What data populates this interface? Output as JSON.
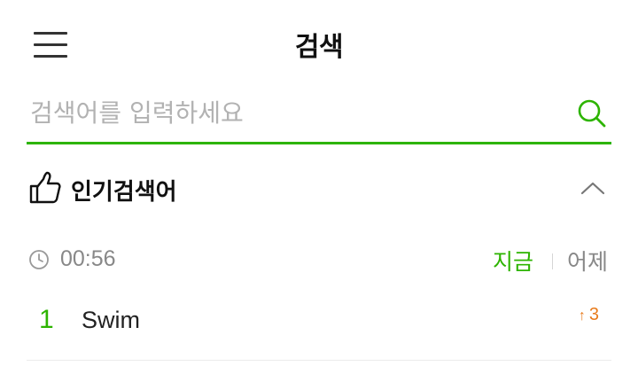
{
  "header": {
    "title": "검색",
    "menu_icon": "hamburger-menu-icon"
  },
  "search": {
    "placeholder": "검색어를 입력하세요",
    "value": "",
    "icon": "search-icon",
    "accent_color": "#2db400"
  },
  "popular": {
    "label": "인기검색어",
    "icon": "thumbs-up-icon",
    "collapse_icon": "chevron-up-icon",
    "time": "00:56",
    "time_icon": "clock-icon",
    "tabs": {
      "now": "지금",
      "yesterday": "어제",
      "active": "now"
    },
    "items": [
      {
        "rank": "1",
        "keyword": "Swim",
        "change": "3",
        "change_direction": "up",
        "change_color": "#e87b1c"
      }
    ]
  }
}
